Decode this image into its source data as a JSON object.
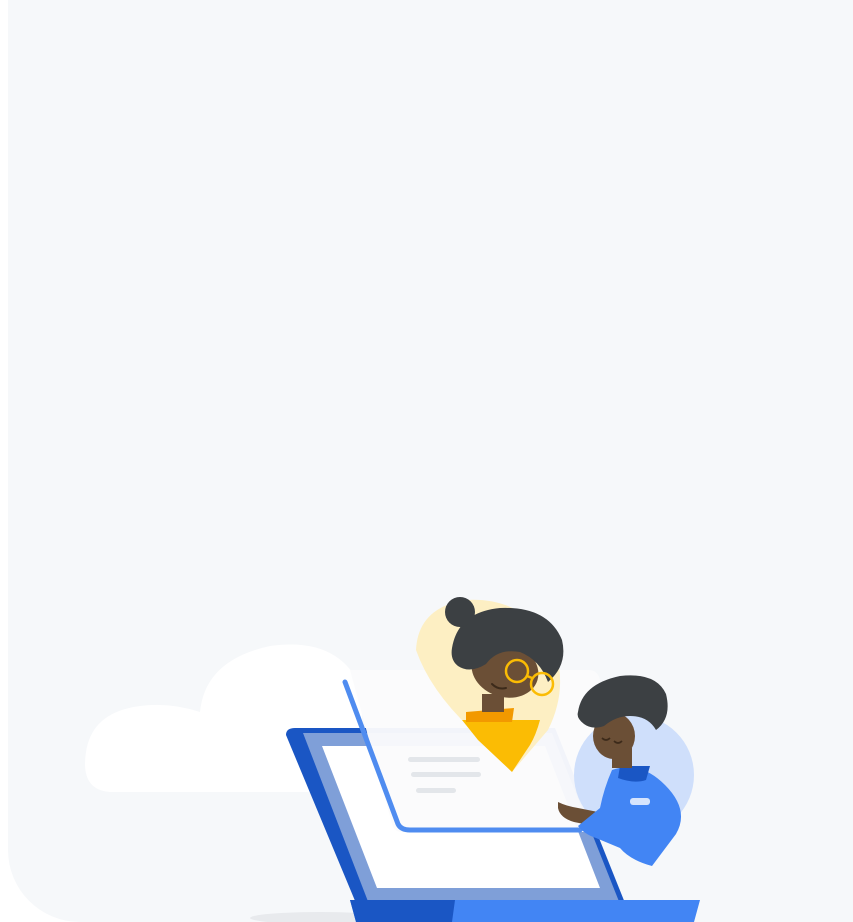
{
  "panel": {
    "background": "#f6f8fa"
  },
  "illustration": {
    "icon": "video-call-illustration",
    "colors": {
      "cloud": "#ffffff",
      "laptop_frame": "#1a56c4",
      "laptop_bezel": "#7f9fd8",
      "laptop_screen": "#ffffff",
      "accent_blue": "#4285f4",
      "accent_yellow": "#fbbc04",
      "pale_yellow": "#fdefc3",
      "pale_blue": "#cfdffb",
      "hair": "#3c4043",
      "skin": "#6b4f36",
      "text_lines": "#e3e6ea"
    }
  }
}
